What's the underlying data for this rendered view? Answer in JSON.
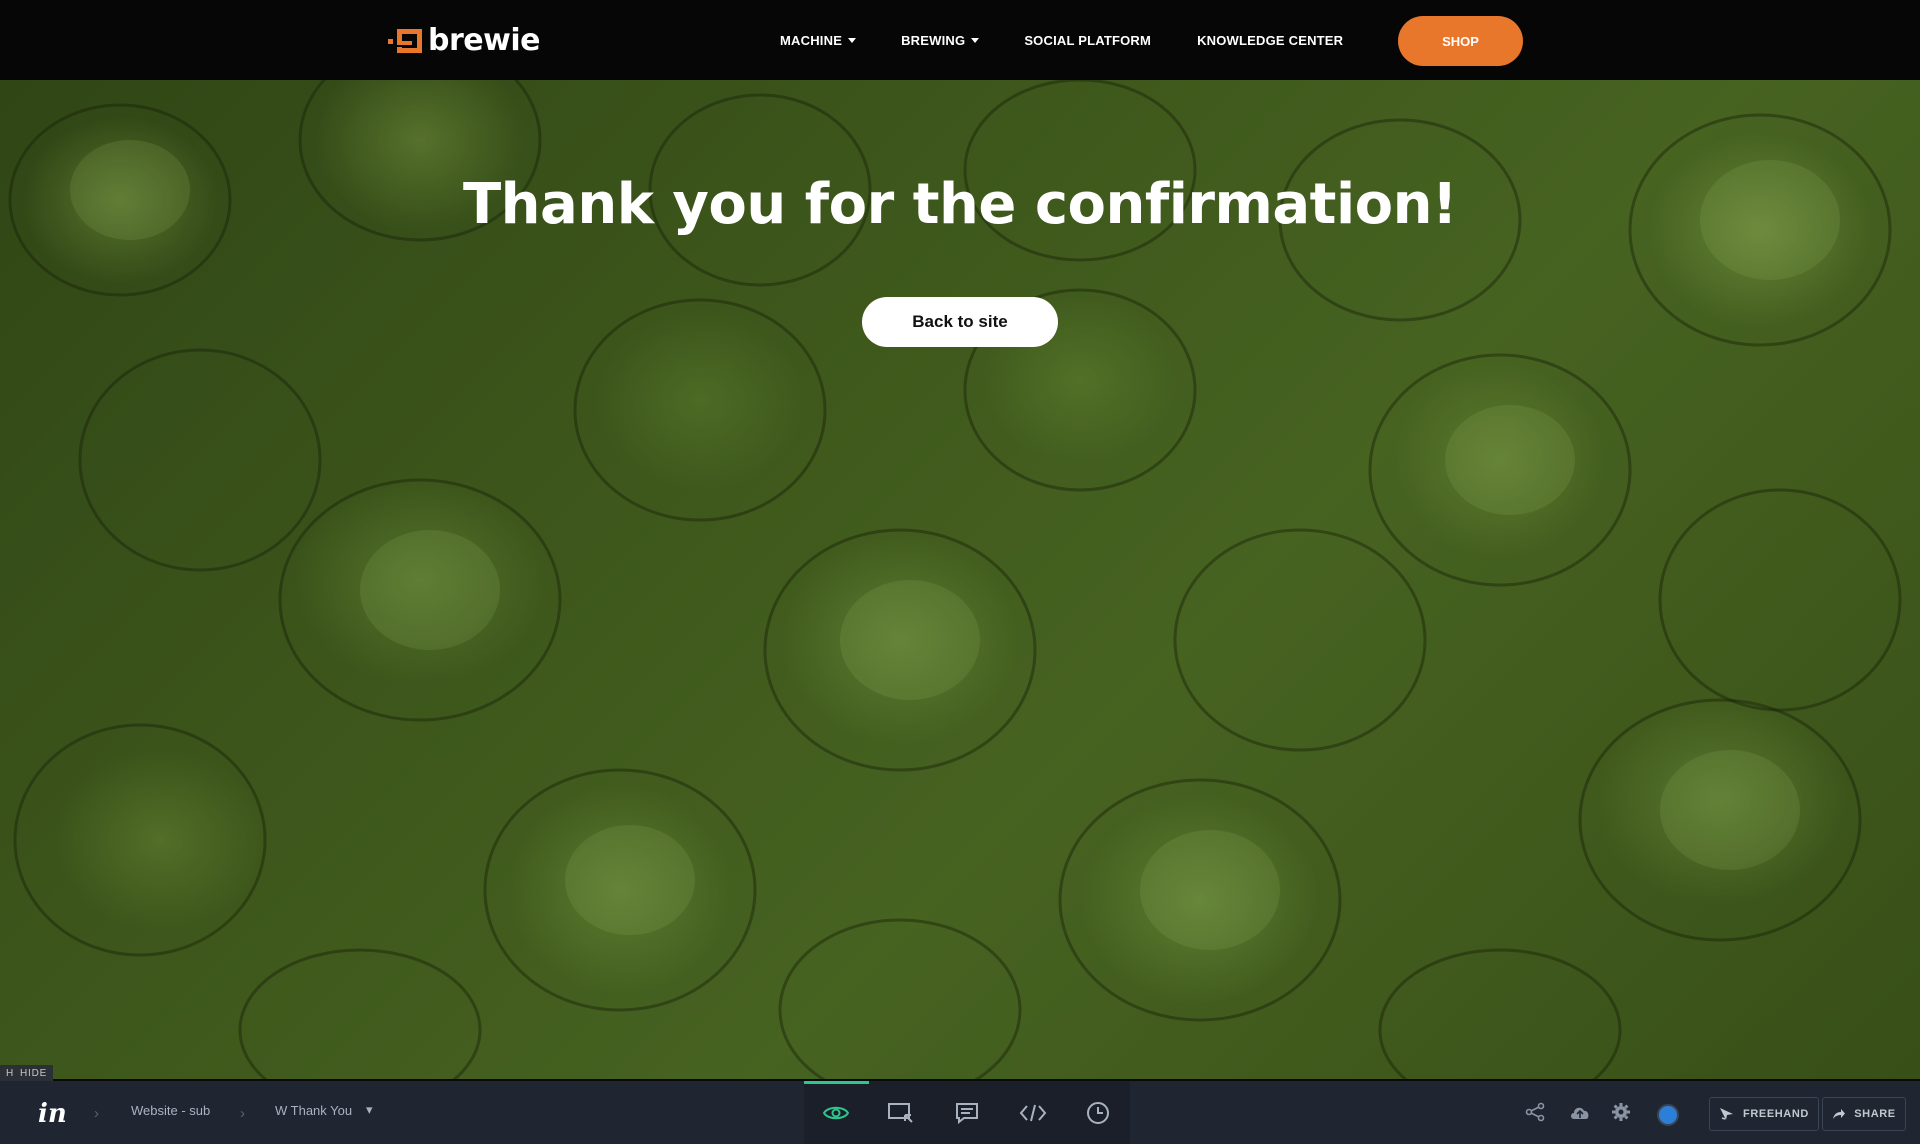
{
  "brand": {
    "name": "brewie"
  },
  "nav": {
    "items": [
      {
        "label": "MACHINE",
        "has_dropdown": true
      },
      {
        "label": "BREWING",
        "has_dropdown": true
      },
      {
        "label": "SOCIAL PLATFORM",
        "has_dropdown": false
      },
      {
        "label": "KNOWLEDGE CENTER",
        "has_dropdown": false
      }
    ],
    "shop_label": "SHOP"
  },
  "hero": {
    "title": "Thank you for the confirmation!",
    "button_label": "Back to site"
  },
  "hide_toggle": {
    "key": "H",
    "label": "HIDE"
  },
  "toolbar": {
    "logo_text": "in",
    "breadcrumbs": [
      "Website - sub",
      "W Thank You"
    ],
    "modes": [
      "preview-eye-icon",
      "build-inspect-icon",
      "comment-icon",
      "code-icon",
      "history-clock-icon"
    ],
    "active_mode": "preview-eye-icon",
    "freehand_label": "FREEHAND",
    "share_label": "SHARE"
  },
  "colors": {
    "accent": "#e8762b",
    "header_bg": "#060606",
    "toolbar_bg": "#1f2531",
    "active_mode": "#30c58e",
    "avatar": "#2b7fd6"
  }
}
